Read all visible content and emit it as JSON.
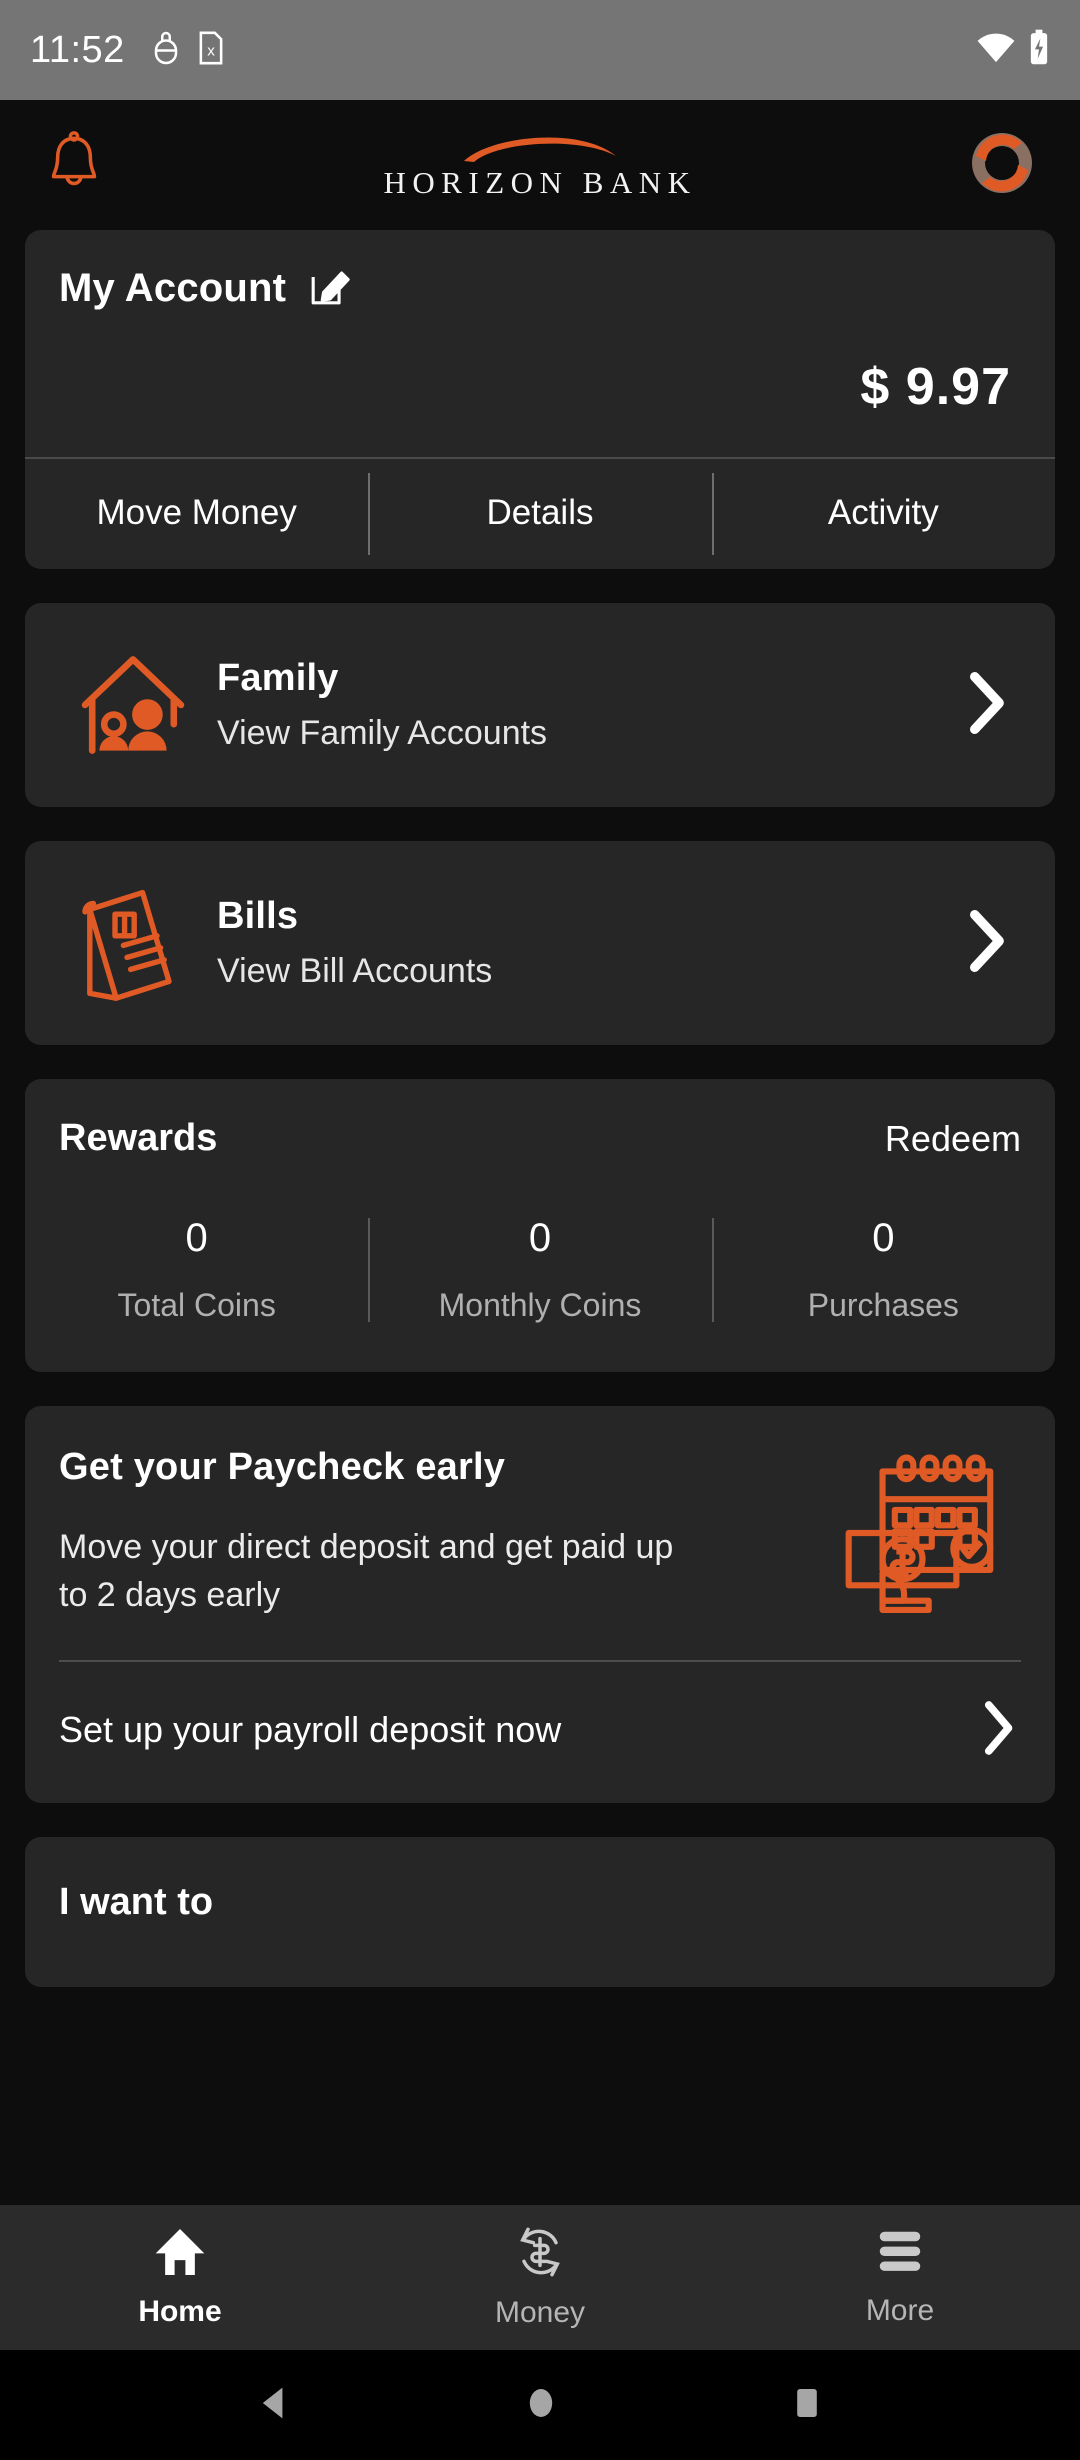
{
  "status_bar": {
    "time": "11:52",
    "icons": [
      "android-debug-icon",
      "sim-card-off-icon",
      "wifi-icon",
      "battery-charging-icon"
    ]
  },
  "header": {
    "notification_icon": "bell-icon",
    "brand_name": "HORIZON BANK",
    "avatar_icon": "profile-avatar-icon"
  },
  "account_card": {
    "title": "My Account",
    "edit_icon": "edit-pencil-icon",
    "balance": "$ 9.97",
    "tabs": [
      {
        "label": "Move Money"
      },
      {
        "label": "Details"
      },
      {
        "label": "Activity"
      }
    ]
  },
  "family_card": {
    "icon": "house-family-icon",
    "title": "Family",
    "subtitle": "View Family Accounts",
    "chevron": "chevron-right-icon"
  },
  "bills_card": {
    "icon": "bill-invoice-icon",
    "title": "Bills",
    "subtitle": "View Bill Accounts",
    "chevron": "chevron-right-icon"
  },
  "rewards_card": {
    "title": "Rewards",
    "redeem_label": "Redeem",
    "stats": [
      {
        "value": "0",
        "label": "Total Coins"
      },
      {
        "value": "0",
        "label": "Monthly Coins"
      },
      {
        "value": "0",
        "label": "Purchases"
      }
    ]
  },
  "paycheck_card": {
    "title": "Get your Paycheck early",
    "description": "Move your direct deposit and get paid up to 2 days early",
    "icon": "calendar-paycheck-icon",
    "cta_label": "Set up your payroll deposit now",
    "chevron": "chevron-right-icon"
  },
  "i_want_to_card": {
    "title": "I want to"
  },
  "bottom_nav": {
    "items": [
      {
        "label": "Home",
        "icon": "home-icon",
        "active": true
      },
      {
        "label": "Money",
        "icon": "money-exchange-icon",
        "active": false
      },
      {
        "label": "More",
        "icon": "menu-bars-icon",
        "active": false
      }
    ]
  },
  "android_nav": {
    "back": "back-triangle-icon",
    "home": "home-circle-icon",
    "recents": "recents-square-icon"
  },
  "colors": {
    "accent_orange": "#E05A26",
    "page_background": "#0d0d0d",
    "card_background": "#262626",
    "status_bar": "#757575",
    "nav_background": "#2b2b2b"
  }
}
